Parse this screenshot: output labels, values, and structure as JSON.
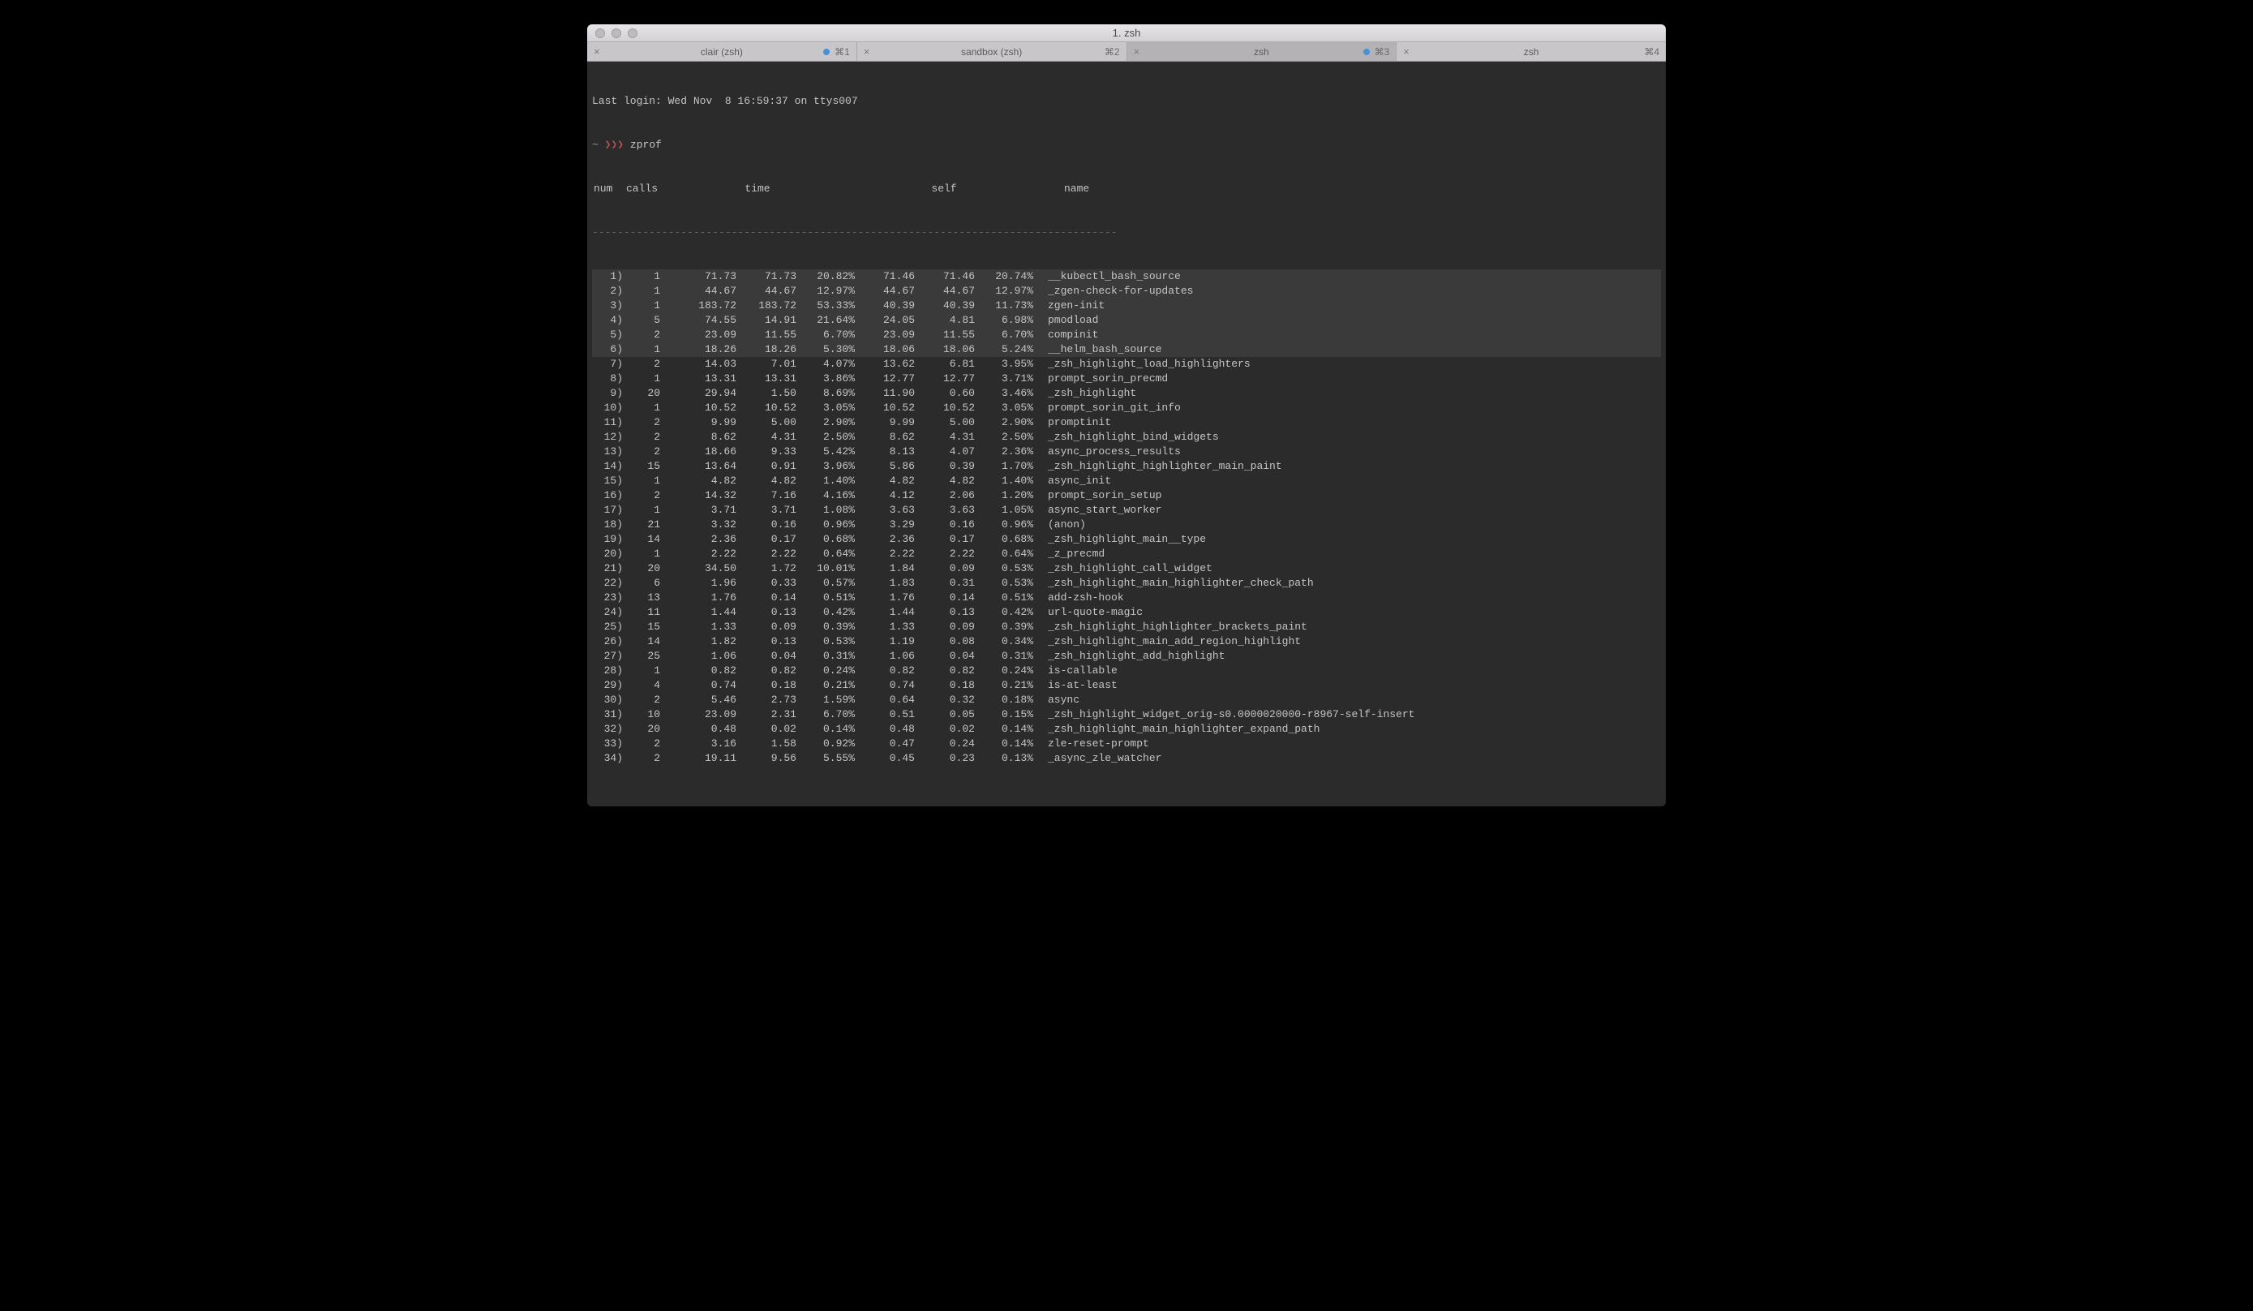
{
  "window": {
    "title": "1. zsh"
  },
  "tabs": [
    {
      "title": "clair (zsh)",
      "shortcut": "⌘1",
      "dirty": true,
      "active": false
    },
    {
      "title": "sandbox (zsh)",
      "shortcut": "⌘2",
      "dirty": false,
      "active": false
    },
    {
      "title": "zsh",
      "shortcut": "⌘3",
      "dirty": true,
      "active": true
    },
    {
      "title": "zsh",
      "shortcut": "⌘4",
      "dirty": false,
      "active": false
    }
  ],
  "login_line": "Last login: Wed Nov  8 16:59:37 on ttys007",
  "prompt": {
    "tilde": "~",
    "arrows": "❯❯❯",
    "cmd": "zprof"
  },
  "columns": {
    "num": "num",
    "calls": "calls",
    "time": "time",
    "self": "self",
    "name": "name"
  },
  "divider": "-----------------------------------------------------------------------------------",
  "rows": [
    {
      "hl": true,
      "num": "1)",
      "calls": "1",
      "t1": "71.73",
      "t2": "71.73",
      "t3": "20.82%",
      "s1": "71.46",
      "s2": "71.46",
      "s3": "20.74%",
      "name": "__kubectl_bash_source"
    },
    {
      "hl": true,
      "num": "2)",
      "calls": "1",
      "t1": "44.67",
      "t2": "44.67",
      "t3": "12.97%",
      "s1": "44.67",
      "s2": "44.67",
      "s3": "12.97%",
      "name": "_zgen-check-for-updates"
    },
    {
      "hl": true,
      "num": "3)",
      "calls": "1",
      "t1": "183.72",
      "t2": "183.72",
      "t3": "53.33%",
      "s1": "40.39",
      "s2": "40.39",
      "s3": "11.73%",
      "name": "zgen-init"
    },
    {
      "hl": true,
      "num": "4)",
      "calls": "5",
      "t1": "74.55",
      "t2": "14.91",
      "t3": "21.64%",
      "s1": "24.05",
      "s2": "4.81",
      "s3": "6.98%",
      "name": "pmodload"
    },
    {
      "hl": true,
      "num": "5)",
      "calls": "2",
      "t1": "23.09",
      "t2": "11.55",
      "t3": "6.70%",
      "s1": "23.09",
      "s2": "11.55",
      "s3": "6.70%",
      "name": "compinit"
    },
    {
      "hl": true,
      "num": "6)",
      "calls": "1",
      "t1": "18.26",
      "t2": "18.26",
      "t3": "5.30%",
      "s1": "18.06",
      "s2": "18.06",
      "s3": "5.24%",
      "name": "__helm_bash_source"
    },
    {
      "hl": false,
      "num": "7)",
      "calls": "2",
      "t1": "14.03",
      "t2": "7.01",
      "t3": "4.07%",
      "s1": "13.62",
      "s2": "6.81",
      "s3": "3.95%",
      "name": "_zsh_highlight_load_highlighters"
    },
    {
      "hl": false,
      "num": "8)",
      "calls": "1",
      "t1": "13.31",
      "t2": "13.31",
      "t3": "3.86%",
      "s1": "12.77",
      "s2": "12.77",
      "s3": "3.71%",
      "name": "prompt_sorin_precmd"
    },
    {
      "hl": false,
      "num": "9)",
      "calls": "20",
      "t1": "29.94",
      "t2": "1.50",
      "t3": "8.69%",
      "s1": "11.90",
      "s2": "0.60",
      "s3": "3.46%",
      "name": "_zsh_highlight"
    },
    {
      "hl": false,
      "num": "10)",
      "calls": "1",
      "t1": "10.52",
      "t2": "10.52",
      "t3": "3.05%",
      "s1": "10.52",
      "s2": "10.52",
      "s3": "3.05%",
      "name": "prompt_sorin_git_info"
    },
    {
      "hl": false,
      "num": "11)",
      "calls": "2",
      "t1": "9.99",
      "t2": "5.00",
      "t3": "2.90%",
      "s1": "9.99",
      "s2": "5.00",
      "s3": "2.90%",
      "name": "promptinit"
    },
    {
      "hl": false,
      "num": "12)",
      "calls": "2",
      "t1": "8.62",
      "t2": "4.31",
      "t3": "2.50%",
      "s1": "8.62",
      "s2": "4.31",
      "s3": "2.50%",
      "name": "_zsh_highlight_bind_widgets"
    },
    {
      "hl": false,
      "num": "13)",
      "calls": "2",
      "t1": "18.66",
      "t2": "9.33",
      "t3": "5.42%",
      "s1": "8.13",
      "s2": "4.07",
      "s3": "2.36%",
      "name": "async_process_results"
    },
    {
      "hl": false,
      "num": "14)",
      "calls": "15",
      "t1": "13.64",
      "t2": "0.91",
      "t3": "3.96%",
      "s1": "5.86",
      "s2": "0.39",
      "s3": "1.70%",
      "name": "_zsh_highlight_highlighter_main_paint"
    },
    {
      "hl": false,
      "num": "15)",
      "calls": "1",
      "t1": "4.82",
      "t2": "4.82",
      "t3": "1.40%",
      "s1": "4.82",
      "s2": "4.82",
      "s3": "1.40%",
      "name": "async_init"
    },
    {
      "hl": false,
      "num": "16)",
      "calls": "2",
      "t1": "14.32",
      "t2": "7.16",
      "t3": "4.16%",
      "s1": "4.12",
      "s2": "2.06",
      "s3": "1.20%",
      "name": "prompt_sorin_setup"
    },
    {
      "hl": false,
      "num": "17)",
      "calls": "1",
      "t1": "3.71",
      "t2": "3.71",
      "t3": "1.08%",
      "s1": "3.63",
      "s2": "3.63",
      "s3": "1.05%",
      "name": "async_start_worker"
    },
    {
      "hl": false,
      "num": "18)",
      "calls": "21",
      "t1": "3.32",
      "t2": "0.16",
      "t3": "0.96%",
      "s1": "3.29",
      "s2": "0.16",
      "s3": "0.96%",
      "name": "(anon)"
    },
    {
      "hl": false,
      "num": "19)",
      "calls": "14",
      "t1": "2.36",
      "t2": "0.17",
      "t3": "0.68%",
      "s1": "2.36",
      "s2": "0.17",
      "s3": "0.68%",
      "name": "_zsh_highlight_main__type"
    },
    {
      "hl": false,
      "num": "20)",
      "calls": "1",
      "t1": "2.22",
      "t2": "2.22",
      "t3": "0.64%",
      "s1": "2.22",
      "s2": "2.22",
      "s3": "0.64%",
      "name": "_z_precmd"
    },
    {
      "hl": false,
      "num": "21)",
      "calls": "20",
      "t1": "34.50",
      "t2": "1.72",
      "t3": "10.01%",
      "s1": "1.84",
      "s2": "0.09",
      "s3": "0.53%",
      "name": "_zsh_highlight_call_widget"
    },
    {
      "hl": false,
      "num": "22)",
      "calls": "6",
      "t1": "1.96",
      "t2": "0.33",
      "t3": "0.57%",
      "s1": "1.83",
      "s2": "0.31",
      "s3": "0.53%",
      "name": "_zsh_highlight_main_highlighter_check_path"
    },
    {
      "hl": false,
      "num": "23)",
      "calls": "13",
      "t1": "1.76",
      "t2": "0.14",
      "t3": "0.51%",
      "s1": "1.76",
      "s2": "0.14",
      "s3": "0.51%",
      "name": "add-zsh-hook"
    },
    {
      "hl": false,
      "num": "24)",
      "calls": "11",
      "t1": "1.44",
      "t2": "0.13",
      "t3": "0.42%",
      "s1": "1.44",
      "s2": "0.13",
      "s3": "0.42%",
      "name": "url-quote-magic"
    },
    {
      "hl": false,
      "num": "25)",
      "calls": "15",
      "t1": "1.33",
      "t2": "0.09",
      "t3": "0.39%",
      "s1": "1.33",
      "s2": "0.09",
      "s3": "0.39%",
      "name": "_zsh_highlight_highlighter_brackets_paint"
    },
    {
      "hl": false,
      "num": "26)",
      "calls": "14",
      "t1": "1.82",
      "t2": "0.13",
      "t3": "0.53%",
      "s1": "1.19",
      "s2": "0.08",
      "s3": "0.34%",
      "name": "_zsh_highlight_main_add_region_highlight"
    },
    {
      "hl": false,
      "num": "27)",
      "calls": "25",
      "t1": "1.06",
      "t2": "0.04",
      "t3": "0.31%",
      "s1": "1.06",
      "s2": "0.04",
      "s3": "0.31%",
      "name": "_zsh_highlight_add_highlight"
    },
    {
      "hl": false,
      "num": "28)",
      "calls": "1",
      "t1": "0.82",
      "t2": "0.82",
      "t3": "0.24%",
      "s1": "0.82",
      "s2": "0.82",
      "s3": "0.24%",
      "name": "is-callable"
    },
    {
      "hl": false,
      "num": "29)",
      "calls": "4",
      "t1": "0.74",
      "t2": "0.18",
      "t3": "0.21%",
      "s1": "0.74",
      "s2": "0.18",
      "s3": "0.21%",
      "name": "is-at-least"
    },
    {
      "hl": false,
      "num": "30)",
      "calls": "2",
      "t1": "5.46",
      "t2": "2.73",
      "t3": "1.59%",
      "s1": "0.64",
      "s2": "0.32",
      "s3": "0.18%",
      "name": "async"
    },
    {
      "hl": false,
      "num": "31)",
      "calls": "10",
      "t1": "23.09",
      "t2": "2.31",
      "t3": "6.70%",
      "s1": "0.51",
      "s2": "0.05",
      "s3": "0.15%",
      "name": "_zsh_highlight_widget_orig-s0.0000020000-r8967-self-insert"
    },
    {
      "hl": false,
      "num": "32)",
      "calls": "20",
      "t1": "0.48",
      "t2": "0.02",
      "t3": "0.14%",
      "s1": "0.48",
      "s2": "0.02",
      "s3": "0.14%",
      "name": "_zsh_highlight_main_highlighter_expand_path"
    },
    {
      "hl": false,
      "num": "33)",
      "calls": "2",
      "t1": "3.16",
      "t2": "1.58",
      "t3": "0.92%",
      "s1": "0.47",
      "s2": "0.24",
      "s3": "0.14%",
      "name": "zle-reset-prompt"
    },
    {
      "hl": false,
      "num": "34)",
      "calls": "2",
      "t1": "19.11",
      "t2": "9.56",
      "t3": "5.55%",
      "s1": "0.45",
      "s2": "0.23",
      "s3": "0.13%",
      "name": "_async_zle_watcher"
    }
  ]
}
